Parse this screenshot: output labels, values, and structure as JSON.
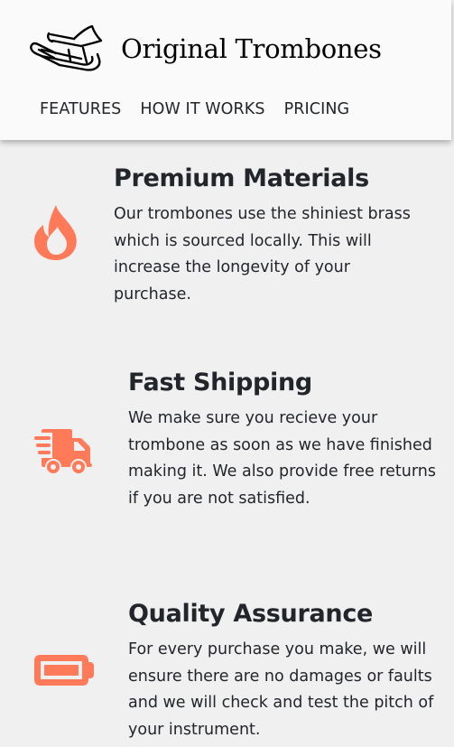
{
  "header": {
    "brand": "Original Trombones",
    "logo_icon": "trombone-icon",
    "nav": [
      {
        "label": "FEATURES"
      },
      {
        "label": "HOW IT WORKS"
      },
      {
        "label": "PRICING"
      }
    ]
  },
  "features": [
    {
      "icon": "fire-icon",
      "title": "Premium Materials",
      "text": "Our trombones use the shiniest brass which is sourced locally. This will increase the longevity of your purchase."
    },
    {
      "icon": "shipping-fast-icon",
      "title": "Fast Shipping",
      "text": "We make sure you recieve your trombone as soon as we have finished making it. We also provide free returns if you are not satisfied."
    },
    {
      "icon": "battery-full-icon",
      "title": "Quality Assurance",
      "text": "For every purchase you make, we will ensure there are no damages or faults and we will check and test the pitch of your instrument."
    }
  ],
  "colors": {
    "accent": "#ff7a59",
    "header_bg": "#fafafa",
    "page_bg": "#f0f0f0",
    "text": "#22252a"
  }
}
